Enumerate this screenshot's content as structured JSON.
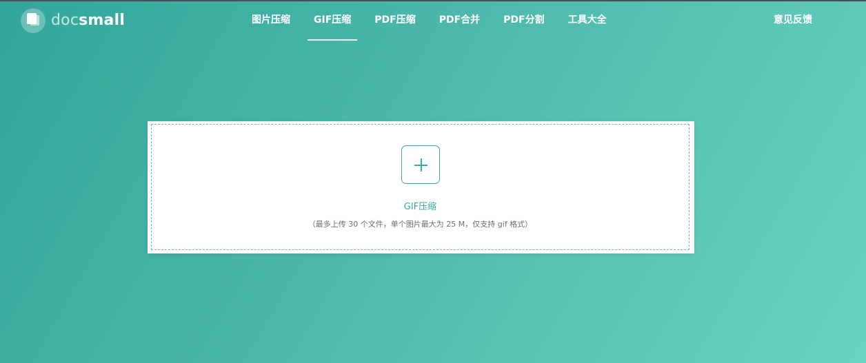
{
  "header": {
    "brand": {
      "part1": "doc",
      "part2": "small"
    },
    "nav": [
      {
        "label": "图片压缩",
        "active": false
      },
      {
        "label": "GIF压缩",
        "active": true
      },
      {
        "label": "PDF压缩",
        "active": false
      },
      {
        "label": "PDF合并",
        "active": false
      },
      {
        "label": "PDF分割",
        "active": false
      },
      {
        "label": "工具大全",
        "active": false
      }
    ],
    "feedback": "意见反馈"
  },
  "upload": {
    "icon": "plus-icon",
    "title": "GIF压缩",
    "hint": "（最多上传 30 个文件，单个图片最大为 25 M，仅支持 gif 格式）"
  },
  "colors": {
    "accent": "#3aa99e",
    "background_start": "#32a69b",
    "background_end": "#6ad2c2"
  }
}
